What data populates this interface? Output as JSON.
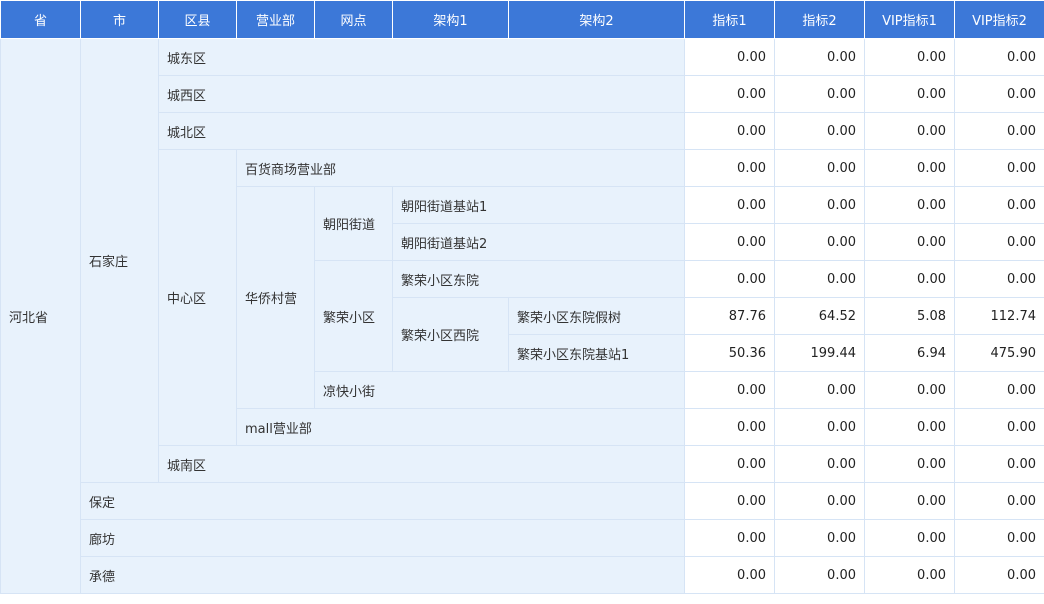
{
  "headers": {
    "province": "省",
    "city": "市",
    "district": "区县",
    "dept": "营业部",
    "outlet": "网点",
    "arch1": "架构1",
    "arch2": "架构2",
    "m1": "指标1",
    "m2": "指标2",
    "vip1": "VIP指标1",
    "vip2": "VIP指标2"
  },
  "labels": {
    "hebei": "河北省",
    "shijiazhuang": "石家庄",
    "chengdong": "城东区",
    "chengxi": "城西区",
    "chengbei": "城北区",
    "zhongxin": "中心区",
    "chengnan": "城南区",
    "baihuo": "百货商场营业部",
    "huaqiao": "华侨村营",
    "mall": "mall营业部",
    "chaoyang": "朝阳街道",
    "fanrong": "繁荣小区",
    "liangkuai": "凉快小街",
    "cy1": "朝阳街道基站1",
    "cy2": "朝阳街道基站2",
    "frdong": "繁荣小区东院",
    "frxi": "繁荣小区西院",
    "frjs": "繁荣小区东院假树",
    "frjz1": "繁荣小区东院基站1",
    "baoding": "保定",
    "langfang": "廊坊",
    "chengde": "承德"
  },
  "rows": [
    [
      "0.00",
      "0.00",
      "0.00",
      "0.00"
    ],
    [
      "0.00",
      "0.00",
      "0.00",
      "0.00"
    ],
    [
      "0.00",
      "0.00",
      "0.00",
      "0.00"
    ],
    [
      "0.00",
      "0.00",
      "0.00",
      "0.00"
    ],
    [
      "0.00",
      "0.00",
      "0.00",
      "0.00"
    ],
    [
      "0.00",
      "0.00",
      "0.00",
      "0.00"
    ],
    [
      "0.00",
      "0.00",
      "0.00",
      "0.00"
    ],
    [
      "87.76",
      "64.52",
      "5.08",
      "112.74"
    ],
    [
      "50.36",
      "199.44",
      "6.94",
      "475.90"
    ],
    [
      "0.00",
      "0.00",
      "0.00",
      "0.00"
    ],
    [
      "0.00",
      "0.00",
      "0.00",
      "0.00"
    ],
    [
      "0.00",
      "0.00",
      "0.00",
      "0.00"
    ],
    [
      "0.00",
      "0.00",
      "0.00",
      "0.00"
    ],
    [
      "0.00",
      "0.00",
      "0.00",
      "0.00"
    ],
    [
      "0.00",
      "0.00",
      "0.00",
      "0.00"
    ]
  ]
}
